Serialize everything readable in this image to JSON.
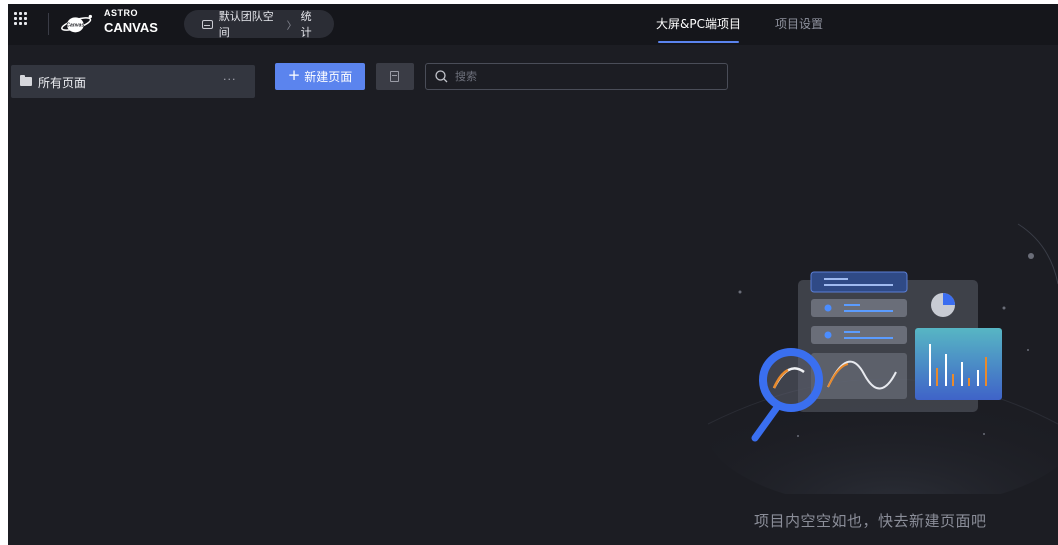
{
  "header": {
    "logo": {
      "top_text": "ASTRO",
      "main_text": "CANVAS",
      "planet_text": "Canvas"
    },
    "breadcrumb": {
      "team": "默认团队空间",
      "project": "统计"
    },
    "tabs": [
      {
        "label": "大屏&PC端项目",
        "active": true
      },
      {
        "label": "项目设置",
        "active": false
      }
    ]
  },
  "sidebar": {
    "items": [
      {
        "label": "所有页面",
        "more": "···"
      }
    ]
  },
  "toolbar": {
    "new_page_label": "新建页面",
    "search_placeholder": "搜索"
  },
  "empty_state": {
    "message": "项目内空空如也，快去新建页面吧"
  },
  "colors": {
    "background": "#1c1d23",
    "header": "#15161b",
    "accent": "#5b84ee",
    "muted_text": "#8b8e99"
  },
  "icons": [
    "apps-grid-icon",
    "logo-planet-icon",
    "monitor-icon",
    "folder-icon",
    "more-icon",
    "plus-icon",
    "import-file-icon",
    "search-icon",
    "empty-illustration"
  ]
}
